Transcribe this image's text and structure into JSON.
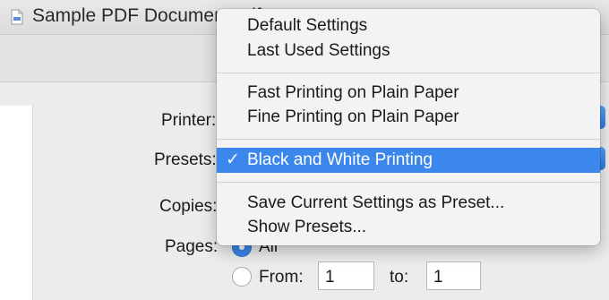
{
  "window": {
    "title": "Sample PDF Document.pdf",
    "icon": "pdf-document-icon"
  },
  "form": {
    "printer_label": "Printer:",
    "presets_label": "Presets:",
    "copies_label": "Copies:",
    "pages_label": "Pages:",
    "pages_all_label": "All",
    "pages_from_label": "From:",
    "pages_to_label": "to:",
    "from_value": "1",
    "to_value": "1"
  },
  "presets_menu": {
    "group1": [
      "Default Settings",
      "Last Used Settings"
    ],
    "group2": [
      "Fast Printing on Plain Paper",
      "Fine Printing on Plain Paper"
    ],
    "selected": "Black and White Printing",
    "check_mark": "✓",
    "group3": [
      "Save Current Settings as Preset...",
      "Show Presets..."
    ]
  },
  "colors": {
    "selection": "#3b87ec",
    "popup_button": "#2f78e0"
  }
}
